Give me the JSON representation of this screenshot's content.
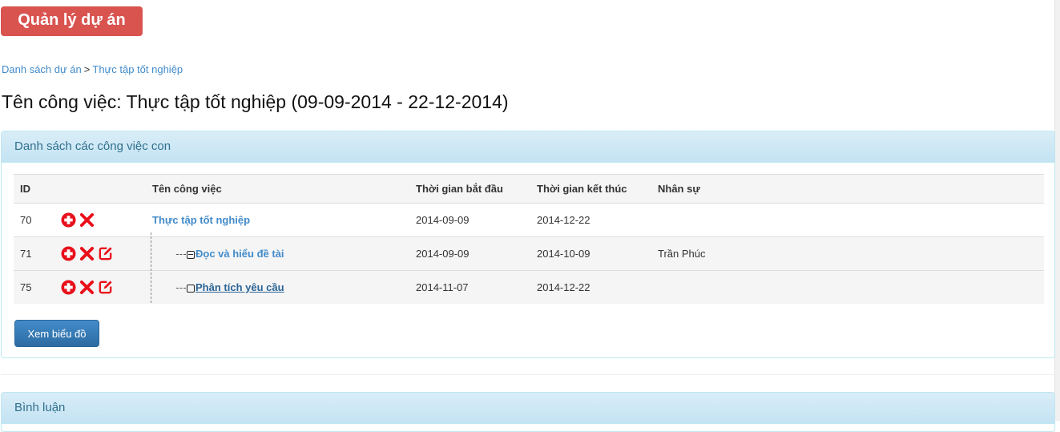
{
  "app": {
    "brand": "Quản lý dự án"
  },
  "breadcrumb": {
    "items": [
      "Danh sách dự án",
      "Thực tập tốt nghiệp"
    ],
    "separator": ">"
  },
  "page": {
    "title": "Tên công việc: Thực tập tốt nghiệp (09-09-2014 - 22-12-2014)"
  },
  "subtasks_panel": {
    "heading": "Danh sách các công việc con",
    "columns": [
      "ID",
      "",
      "Tên công việc",
      "Thời gian bắt đầu",
      "Thời gian kết thúc",
      "Nhân sự"
    ],
    "rows": [
      {
        "id": "70",
        "name": "Thực tập tốt nghiệp",
        "start": "2014-09-09",
        "end": "2014-12-22",
        "staff": ""
      },
      {
        "id": "71",
        "name": "Đọc và hiểu đề tài",
        "start": "2014-09-09",
        "end": "2014-10-09",
        "staff": "Trần Phúc"
      },
      {
        "id": "75",
        "name": "Phân tích yêu cầu",
        "start": "2014-11-07",
        "end": "2014-12-22",
        "staff": ""
      }
    ],
    "chart_button": "Xem biểu đồ"
  },
  "comments_panel": {
    "heading": "Bình luận"
  },
  "colors": {
    "brand": "#d9534f",
    "link": "#428bca",
    "action_icon": "#e8101b",
    "panel_heading": "#31708f"
  }
}
